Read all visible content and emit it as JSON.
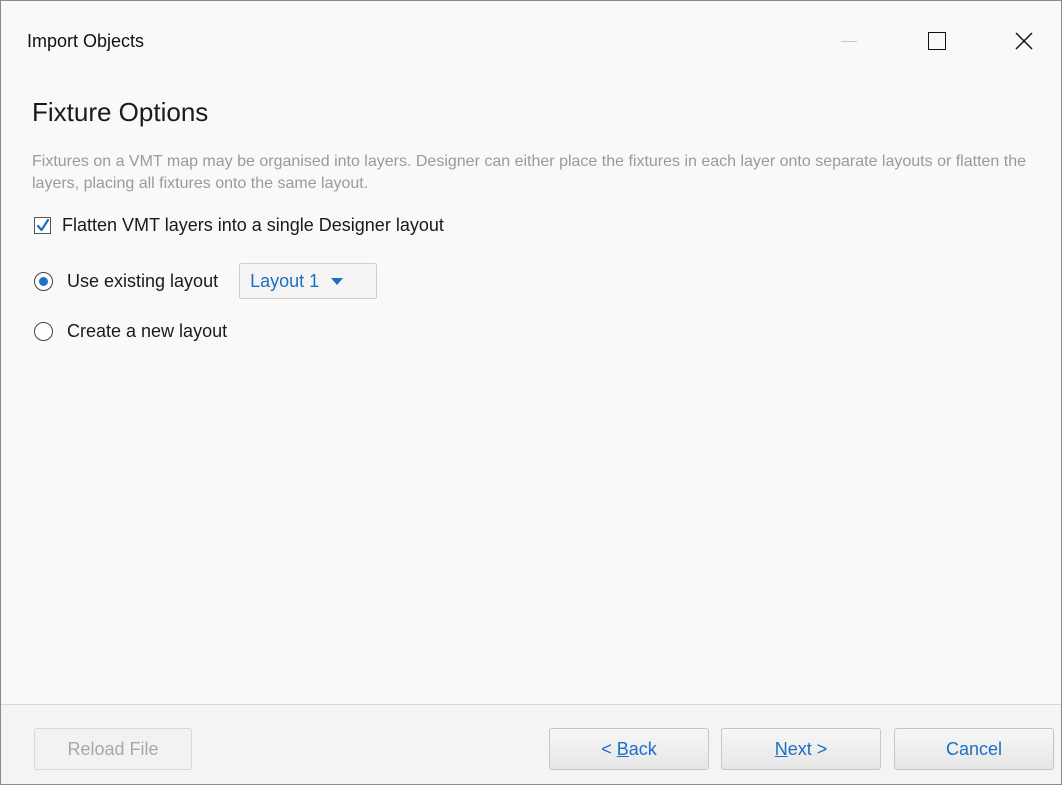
{
  "window": {
    "title": "Import Objects",
    "controls": {
      "minimize_icon": "minimize-icon",
      "maximize_icon": "maximize-icon",
      "close_icon": "close-icon"
    }
  },
  "page": {
    "heading": "Fixture Options",
    "description": "Fixtures on a VMT map may be organised into layers. Designer can either place the fixtures in each layer onto separate layouts or flatten the layers, placing all fixtures onto the same layout."
  },
  "options": {
    "flatten": {
      "label": "Flatten VMT layers into a single Designer layout",
      "checked": true
    },
    "use_existing": {
      "label": "Use existing layout",
      "selected": true,
      "dropdown_value": "Layout 1"
    },
    "create_new": {
      "label": "Create a new layout",
      "selected": false
    }
  },
  "footer": {
    "reload_label": "Reload File",
    "back_prefix": "< ",
    "back_mnemonic": "B",
    "back_rest": "ack",
    "next_mnemonic": "N",
    "next_rest": "ext >",
    "cancel_label": "Cancel"
  },
  "colors": {
    "accent": "#1a6fc2",
    "description_text": "#9a9a9a",
    "background": "#f9f9f9"
  }
}
